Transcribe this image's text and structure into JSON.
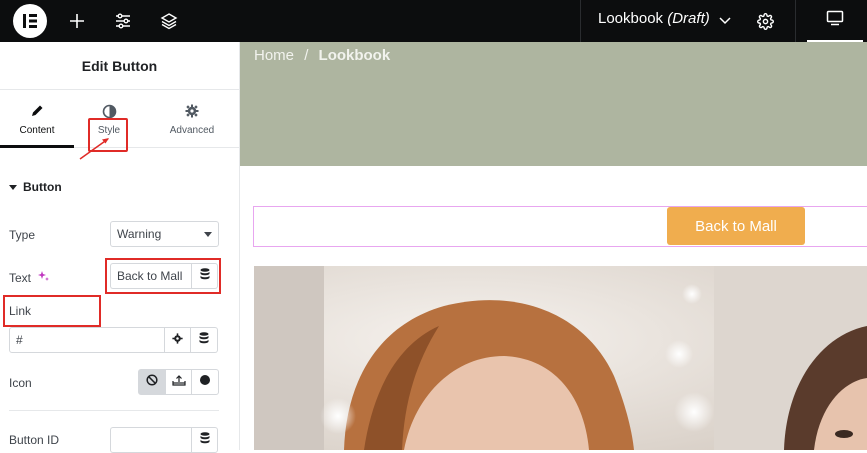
{
  "topbar": {
    "page_name": "Lookbook",
    "page_status": "(Draft)",
    "icons": [
      "elementor-logo-icon",
      "plus-icon",
      "sliders-icon",
      "layers-icon",
      "chevron-down-icon",
      "gear-icon",
      "desktop-icon"
    ]
  },
  "panel": {
    "title": "Edit Button",
    "tabs": [
      {
        "label": "Content",
        "icon": "pencil-icon"
      },
      {
        "label": "Style",
        "icon": "half-circle-icon"
      },
      {
        "label": "Advanced",
        "icon": "gear-icon"
      }
    ],
    "section": "Button",
    "fields": {
      "type_label": "Type",
      "type_value": "Warning",
      "text_label": "Text",
      "text_value": "Back to Mall",
      "link_label": "Link",
      "link_value": "#",
      "icon_label": "Icon",
      "button_id_label": "Button ID",
      "button_id_value": ""
    }
  },
  "canvas": {
    "breadcrumb_home": "Home",
    "breadcrumb_sep": "/",
    "breadcrumb_current": "Lookbook",
    "button_label": "Back to Mall",
    "colors": {
      "hero": "#aeb5a0",
      "button": "#f0ad4e",
      "selection": "#e8a6f0",
      "annotation": "#e02b27"
    }
  }
}
